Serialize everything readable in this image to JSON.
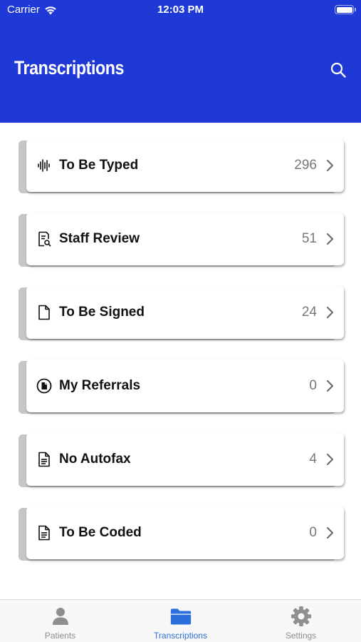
{
  "status_bar": {
    "carrier": "Carrier",
    "time": "12:03 PM"
  },
  "header": {
    "title": "Transcriptions",
    "search_icon": "search-icon"
  },
  "categories": [
    {
      "label": "To Be Typed",
      "count": "296",
      "icon": "waveform-icon"
    },
    {
      "label": "Staff Review",
      "count": "51",
      "icon": "document-search-icon"
    },
    {
      "label": "To Be Signed",
      "count": "24",
      "icon": "document-icon"
    },
    {
      "label": "My Referrals",
      "count": "0",
      "icon": "referral-icon"
    },
    {
      "label": "No Autofax",
      "count": "4",
      "icon": "document-text-icon"
    },
    {
      "label": "To Be Coded",
      "count": "0",
      "icon": "document-text-icon"
    }
  ],
  "tabs": [
    {
      "label": "Patients",
      "icon": "person-icon",
      "active": false
    },
    {
      "label": "Transcriptions",
      "icon": "folder-icon",
      "active": true
    },
    {
      "label": "Settings",
      "icon": "gear-icon",
      "active": false
    }
  ],
  "colors": {
    "header_bg": "#1f39d6",
    "active_tab": "#2a6fdb",
    "inactive_tab": "#8e8e8e"
  }
}
